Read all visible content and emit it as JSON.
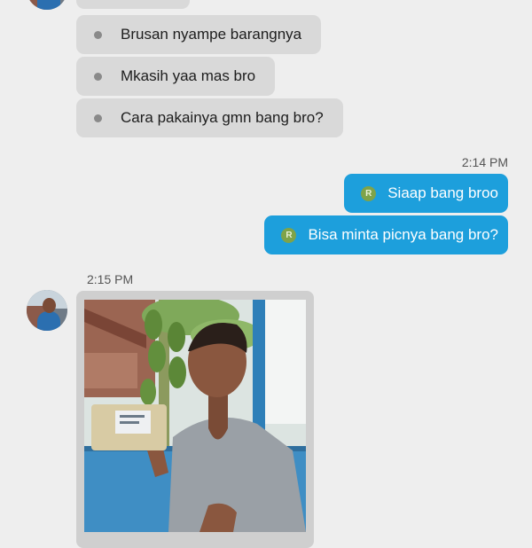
{
  "conversation": {
    "incoming_messages": [
      {
        "text": "Brusan nyampe barangnya"
      },
      {
        "text": "Mkasih yaa mas bro"
      },
      {
        "text": "Cara pakainya gmn bang bro?"
      }
    ],
    "outgoing_timestamp": "2:14 PM",
    "outgoing_messages": [
      {
        "text": "Siaap bang broo",
        "read_badge": "R"
      },
      {
        "text": "Bisa minta picnya bang bro?",
        "read_badge": "R"
      }
    ],
    "photo_timestamp": "2:15 PM"
  },
  "colors": {
    "background": "#eeeeee",
    "incoming_bubble": "#d9d9d9",
    "outgoing_bubble": "#1d9fdc",
    "read_badge": "#7ea34a"
  }
}
